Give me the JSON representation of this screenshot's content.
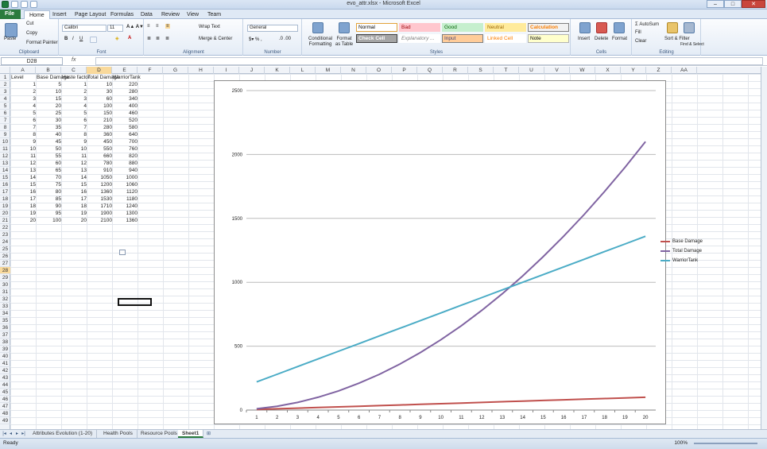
{
  "window": {
    "title": "evo_attr.xlsx - Microsoft Excel"
  },
  "tabs": [
    "File",
    "Home",
    "Insert",
    "Page Layout",
    "Formulas",
    "Data",
    "Review",
    "View",
    "Team"
  ],
  "active_tab": "Home",
  "ribbon": {
    "clipboard": {
      "label": "Clipboard",
      "paste": "Paste",
      "cut": "Cut",
      "copy": "Copy",
      "format_painter": "Format Painter"
    },
    "font": {
      "label": "Font",
      "name": "Calibri",
      "size": "11"
    },
    "alignment": {
      "label": "Alignment",
      "wrap": "Wrap Text",
      "merge": "Merge & Center"
    },
    "number": {
      "label": "Number",
      "format": "General"
    },
    "styles": {
      "label": "Styles",
      "cond": "Conditional Formatting",
      "table": "Format as Table",
      "items": [
        {
          "t": "Normal",
          "bg": "#ffffff",
          "fg": "#000000",
          "bd": "#e2a33a"
        },
        {
          "t": "Bad",
          "bg": "#ffc7ce",
          "fg": "#9c0006",
          "bd": "#ffc7ce"
        },
        {
          "t": "Good",
          "bg": "#c6efce",
          "fg": "#006100",
          "bd": "#c6efce"
        },
        {
          "t": "Neutral",
          "bg": "#ffeb9c",
          "fg": "#9c6500",
          "bd": "#ffeb9c"
        },
        {
          "t": "Calculation",
          "bg": "#f2f2f2",
          "fg": "#fa7d00",
          "bd": "#7f7f7f"
        },
        {
          "t": "Check Cell",
          "bg": "#a5a5a5",
          "fg": "#ffffff",
          "bd": "#3f3f3f"
        },
        {
          "t": "Explanatory ...",
          "bg": "#ffffff",
          "fg": "#7f7f7f",
          "bd": "#ffffff"
        },
        {
          "t": "Input",
          "bg": "#ffcc99",
          "fg": "#3f3f76",
          "bd": "#7f7f7f"
        },
        {
          "t": "Linked Cell",
          "bg": "#ffffff",
          "fg": "#fa7d00",
          "bd": "#ffffff"
        },
        {
          "t": "Note",
          "bg": "#ffffcc",
          "fg": "#000000",
          "bd": "#b2b2b2"
        }
      ]
    },
    "cells": {
      "label": "Cells",
      "insert": "Insert",
      "delete": "Delete",
      "format": "Format"
    },
    "editing": {
      "label": "Editing",
      "autosum": "AutoSum",
      "fill": "Fill",
      "clear": "Clear",
      "sort": "Sort & Filter",
      "find": "Find & Select"
    }
  },
  "formula_bar": {
    "name_box": "D28",
    "fx": "fx",
    "value": ""
  },
  "columns": [
    "A",
    "B",
    "C",
    "D",
    "E",
    "F",
    "G",
    "H",
    "I",
    "J",
    "K",
    "L",
    "M",
    "N",
    "O",
    "P",
    "Q",
    "R",
    "S",
    "T",
    "U",
    "V",
    "W",
    "X",
    "Y",
    "Z",
    "AA"
  ],
  "selected_column": "D",
  "selected_row": 28,
  "headers": [
    "Level",
    "Base Damage",
    "Haste factor",
    "Total Damage",
    "WarriorTank"
  ],
  "rows": [
    [
      1,
      5,
      1,
      10,
      220
    ],
    [
      2,
      10,
      2,
      30,
      280
    ],
    [
      3,
      15,
      3,
      60,
      340
    ],
    [
      4,
      20,
      4,
      100,
      400
    ],
    [
      5,
      25,
      5,
      150,
      460
    ],
    [
      6,
      30,
      6,
      210,
      520
    ],
    [
      7,
      35,
      7,
      280,
      580
    ],
    [
      8,
      40,
      8,
      360,
      640
    ],
    [
      9,
      45,
      9,
      450,
      700
    ],
    [
      10,
      50,
      10,
      550,
      760
    ],
    [
      11,
      55,
      11,
      660,
      820
    ],
    [
      12,
      60,
      12,
      780,
      880
    ],
    [
      13,
      65,
      13,
      910,
      940
    ],
    [
      14,
      70,
      14,
      1050,
      1000
    ],
    [
      15,
      75,
      15,
      1200,
      1060
    ],
    [
      16,
      80,
      16,
      1360,
      1120
    ],
    [
      17,
      85,
      17,
      1530,
      1180
    ],
    [
      18,
      90,
      18,
      1710,
      1240
    ],
    [
      19,
      95,
      19,
      1900,
      1300
    ],
    [
      20,
      100,
      20,
      2100,
      1360
    ]
  ],
  "chart_data": {
    "type": "line",
    "x": [
      1,
      2,
      3,
      4,
      5,
      6,
      7,
      8,
      9,
      10,
      11,
      12,
      13,
      14,
      15,
      16,
      17,
      18,
      19,
      20
    ],
    "ylim": [
      0,
      2500
    ],
    "yticks": [
      0,
      500,
      1000,
      1500,
      2000,
      2500
    ],
    "legend_position": "right",
    "grid": true,
    "series": [
      {
        "name": "Base Damage",
        "color": "#c0504d",
        "values": [
          5,
          10,
          15,
          20,
          25,
          30,
          35,
          40,
          45,
          50,
          55,
          60,
          65,
          70,
          75,
          80,
          85,
          90,
          95,
          100
        ]
      },
      {
        "name": "Total Damage",
        "color": "#8064a2",
        "values": [
          10,
          30,
          60,
          100,
          150,
          210,
          280,
          360,
          450,
          550,
          660,
          780,
          910,
          1050,
          1200,
          1360,
          1530,
          1710,
          1900,
          2100
        ]
      },
      {
        "name": "WarriorTank",
        "color": "#4bacc6",
        "values": [
          220,
          280,
          340,
          400,
          460,
          520,
          580,
          640,
          700,
          760,
          820,
          880,
          940,
          1000,
          1060,
          1120,
          1180,
          1240,
          1300,
          1360
        ]
      }
    ]
  },
  "sheets": [
    "Attributes Evolution (1-20)",
    "Health Pools",
    "Resource Pools",
    "Sheet1"
  ],
  "active_sheet": "Sheet1",
  "status": {
    "ready": "Ready",
    "zoom": "100%"
  }
}
